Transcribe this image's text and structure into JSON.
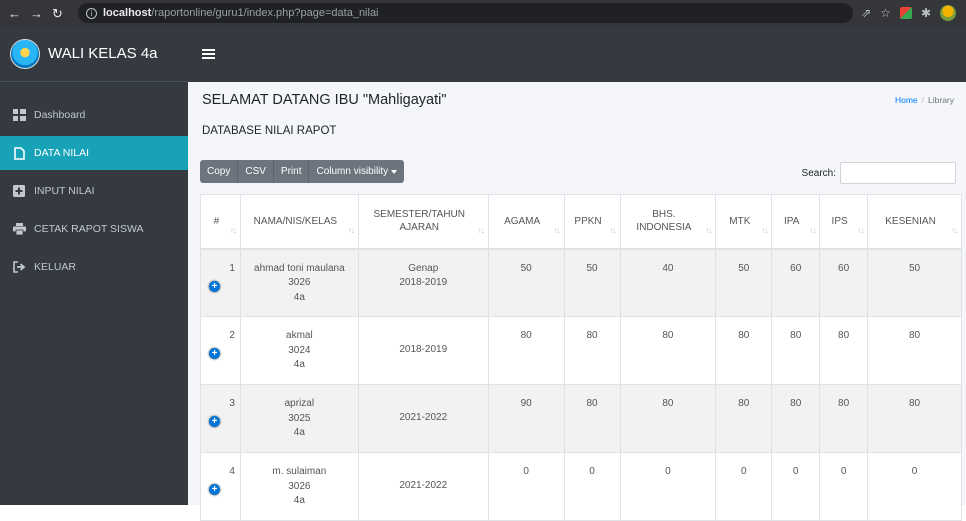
{
  "browser": {
    "url_host": "localhost",
    "url_path": "/raportonline/guru1/index.php?page=data_nilai"
  },
  "brand": {
    "title": "WALI KELAS 4a"
  },
  "sidebar": {
    "items": [
      {
        "label": "Dashboard",
        "icon": "dashboard-icon"
      },
      {
        "label": "DATA NILAI",
        "icon": "file-icon"
      },
      {
        "label": "INPUT NILAI",
        "icon": "plus-square-icon"
      },
      {
        "label": "CETAK RAPOT SISWA",
        "icon": "print-icon"
      },
      {
        "label": "KELUAR",
        "icon": "sign-out-icon"
      }
    ]
  },
  "page": {
    "title": "SELAMAT DATANG IBU \"Mahligayati\"",
    "subtitle": "DATABASE NILAI RAPOT",
    "breadcrumb": {
      "home": "Home",
      "current": "Library"
    }
  },
  "toolbar": {
    "copy": "Copy",
    "csv": "CSV",
    "print": "Print",
    "colvis": "Column visibility",
    "search_label": "Search:"
  },
  "table": {
    "headers": [
      "#",
      "NAMA/NIS/KELAS",
      "SEMESTER/TAHUN AJARAN",
      "AGAMA",
      "PPKN",
      "BHS. INDONESIA",
      "MTK",
      "IPA",
      "IPS",
      "KESENIAN"
    ],
    "rows": [
      {
        "no": "1",
        "nama": "ahmad toni maulana",
        "nis": "3026",
        "kelas": "4a",
        "semester": "Genap",
        "tahun": "2018-2019",
        "agama": "50",
        "ppkn": "50",
        "bindo": "40",
        "mtk": "50",
        "ipa": "60",
        "ips": "60",
        "kesenian": "50"
      },
      {
        "no": "2",
        "nama": "akmal",
        "nis": "3024",
        "kelas": "4a",
        "semester": "",
        "tahun": "2018-2019",
        "agama": "80",
        "ppkn": "80",
        "bindo": "80",
        "mtk": "80",
        "ipa": "80",
        "ips": "80",
        "kesenian": "80"
      },
      {
        "no": "3",
        "nama": "aprizal",
        "nis": "3025",
        "kelas": "4a",
        "semester": "",
        "tahun": "2021-2022",
        "agama": "90",
        "ppkn": "80",
        "bindo": "80",
        "mtk": "80",
        "ipa": "80",
        "ips": "80",
        "kesenian": "80"
      },
      {
        "no": "4",
        "nama": "m. sulaiman",
        "nis": "3026",
        "kelas": "4a",
        "semester": "",
        "tahun": "2021-2022",
        "agama": "0",
        "ppkn": "0",
        "bindo": "0",
        "mtk": "0",
        "ipa": "0",
        "ips": "0",
        "kesenian": "0"
      }
    ]
  }
}
